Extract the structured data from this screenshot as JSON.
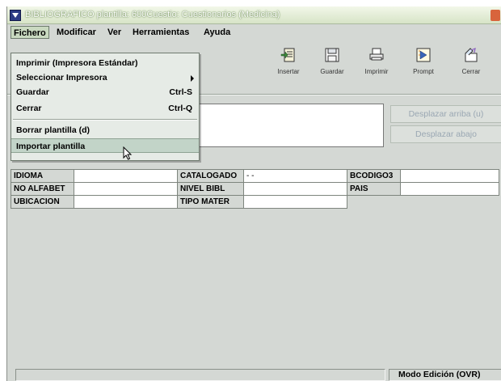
{
  "window": {
    "title": "BIBLIOGRAFICO plantilla: 600Cuestio: Cuestionarios (Medicina)"
  },
  "menubar": {
    "items": [
      {
        "label": "Fichero",
        "active": true
      },
      {
        "label": "Modificar"
      },
      {
        "label": "Ver"
      },
      {
        "label": "Herramientas"
      },
      {
        "label": "Ayuda"
      }
    ]
  },
  "file_menu": {
    "items": [
      {
        "label": "Imprimir (Impresora Estándar)",
        "shortcut": ""
      },
      {
        "label": "Seleccionar Impresora",
        "submenu": true
      },
      {
        "label": "Guardar",
        "shortcut": "Ctrl-S"
      },
      {
        "label": "Cerrar",
        "shortcut": "Ctrl-Q"
      },
      {
        "label": "Borrar plantilla (d)",
        "shortcut": ""
      },
      {
        "label": "Importar plantilla",
        "shortcut": "",
        "highlighted": true
      }
    ]
  },
  "toolbar": {
    "buttons": [
      {
        "label": "Insertar",
        "icon": "insert-icon"
      },
      {
        "label": "Guardar",
        "icon": "save-icon"
      },
      {
        "label": "Imprimir",
        "icon": "print-icon"
      },
      {
        "label": "Prompt",
        "icon": "prompt-icon"
      },
      {
        "label": "Cerrar",
        "icon": "close-door-icon"
      }
    ]
  },
  "side_buttons": {
    "up": "Desplazar arriba (u)",
    "down": "Desplazar abajo"
  },
  "fields": {
    "row1": [
      {
        "label": "IDIOMA",
        "value": ""
      },
      {
        "label": "CATALOGADO",
        "value": "- -"
      },
      {
        "label": "BCODIGO3",
        "value": ""
      }
    ],
    "row2": [
      {
        "label": "NO ALFABET",
        "value": ""
      },
      {
        "label": "NIVEL BIBL",
        "value": ""
      },
      {
        "label": "PAIS",
        "value": ""
      }
    ],
    "row3": [
      {
        "label": "UBICACION",
        "value": ""
      },
      {
        "label": "TIPO MATER",
        "value": ""
      }
    ]
  },
  "status": {
    "mode": "Modo Edición (OVR)"
  },
  "colors": {
    "disabled_text": "#9aa7b3",
    "menu_highlight": "#c2d4c8",
    "window_bg": "#d4d8d4"
  }
}
